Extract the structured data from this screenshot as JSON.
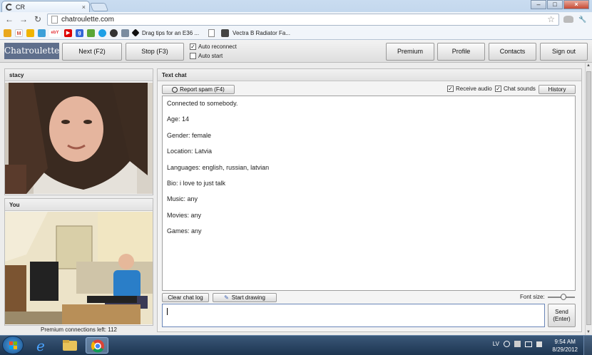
{
  "browser": {
    "tab_title": "CR",
    "tab_close": "×",
    "url": "chatroulette.com",
    "window_controls": {
      "minimize": "–",
      "maximize": "□",
      "close": "×"
    },
    "nav": {
      "back": "←",
      "forward": "→",
      "reload": "↻",
      "star": "☆",
      "wrench": "🔧"
    },
    "bookmarks": {
      "items": [
        {
          "icon": "bookmark-icon-yellow",
          "color": "#e9a81e"
        },
        {
          "icon": "gmail-icon",
          "color": "#d14836",
          "glyph": "M"
        },
        {
          "icon": "flag-icon",
          "color": "#f0b400"
        },
        {
          "icon": "twitter-icon",
          "color": "#3da0d8"
        },
        {
          "icon": "ebay-icon",
          "color": "#e53238",
          "glyph": "ebY"
        },
        {
          "icon": "youtube-icon",
          "color": "#d00",
          "glyph": "▶"
        },
        {
          "icon": "google-icon",
          "color": "#3367d6",
          "glyph": "g"
        },
        {
          "icon": "evernote-icon",
          "color": "#5aa636"
        },
        {
          "icon": "skype-icon",
          "color": "#1ea0e6"
        },
        {
          "icon": "ninja-icon",
          "color": "#333"
        },
        {
          "icon": "mail-icon",
          "color": "#7a8ca0"
        }
      ],
      "drag_tips": "Drag tips for an E36 ...",
      "vectra": "Vectra B Radiator Fa..."
    }
  },
  "app": {
    "logo": "Chatroulette",
    "buttons": {
      "next": "Next (F2)",
      "stop": "Stop (F3)",
      "premium": "Premium",
      "profile": "Profile",
      "contacts": "Contacts",
      "sign_out": "Sign out"
    },
    "options": {
      "auto_reconnect": "Auto reconnect",
      "auto_start": "Auto start",
      "check": "✓"
    },
    "stranger_name": "stacy",
    "you_label": "You",
    "premium_left": "Premium connections left: 112",
    "text_chat": {
      "title": "Text chat",
      "report_spam": "Report spam (F4)",
      "receive_audio": "Receive audio",
      "chat_sounds": "Chat sounds",
      "history": "History",
      "messages": [
        "Connected to somebody.",
        "Age: 14",
        "Gender: female",
        "Location: Latvia",
        "Languages: english, russian, latvian",
        "Bio: i love to just talk",
        "Music: any",
        "Movies: any",
        "Games: any"
      ],
      "clear_chat_log": "Clear chat log",
      "start_drawing": "Start drawing",
      "font_size": "Font size:",
      "font_size_level": 0.6,
      "message_value": "",
      "send_line1": "Send",
      "send_line2": "(Enter)"
    }
  },
  "taskbar": {
    "language": "LV",
    "time": "9:54 AM",
    "date": "8/29/2012",
    "colors": {
      "ie": "#2a7fd4",
      "folder": "#e8c35a",
      "chrome_active": "#6f8fb8"
    }
  }
}
